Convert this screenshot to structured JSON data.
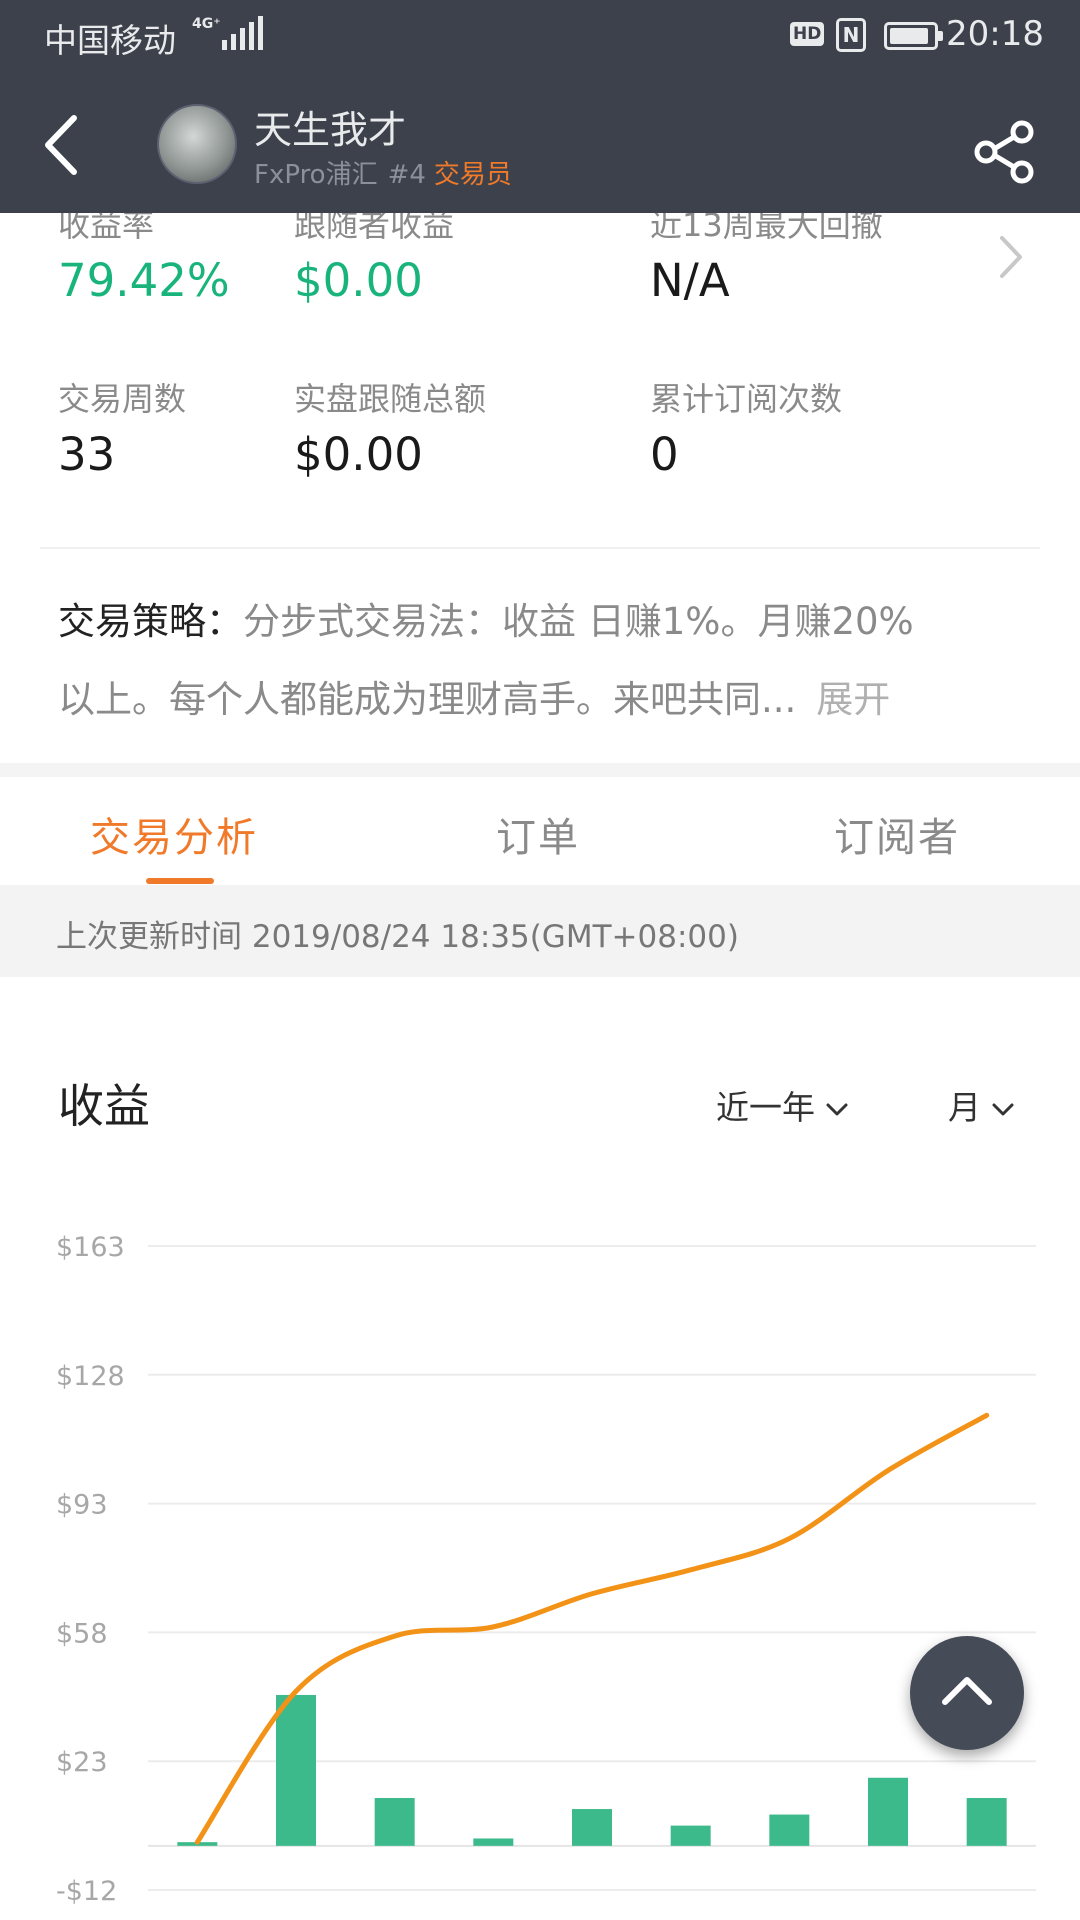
{
  "status_bar": {
    "carrier": "中国移动",
    "network": "4G⁺",
    "hd": "HD",
    "nfc": "N",
    "battery_level": 0.9,
    "time": "20:18"
  },
  "header": {
    "name": "天生我才",
    "broker": "FxPro浦汇",
    "rank": "#4",
    "role": "交易员",
    "back_icon": "back-arrow-icon",
    "share_icon": "share-icon",
    "bg_color": "#3c414b"
  },
  "stats": {
    "return_rate": {
      "label": "收益率",
      "value": "79.42%"
    },
    "follower_profit": {
      "label": "跟随者收益",
      "value": "$0.00"
    },
    "max_drawdown": {
      "label": "近13周最大回撤",
      "value": "N/A"
    },
    "trade_weeks": {
      "label": "交易周数",
      "value": "33"
    },
    "live_follow_total": {
      "label": "实盘跟随总额",
      "value": "$0.00"
    },
    "total_subscriptions": {
      "label": "累计订阅次数",
      "value": "0"
    }
  },
  "strategy": {
    "label": "交易策略：",
    "line1": "分步式交易法：收益 日赚1%。月赚20%",
    "line2": "以上。每个人都能成为理财高手。来吧共同...",
    "expand": "展开"
  },
  "tabs": [
    {
      "label": "交易分析",
      "active": true
    },
    {
      "label": "订单",
      "active": false
    },
    {
      "label": "订阅者",
      "active": false
    }
  ],
  "last_updated": "上次更新时间 2019/08/24 18:35(GMT+08:00)",
  "chart_section": {
    "title": "收益",
    "period_filter": "近一年",
    "interval_filter": "月"
  },
  "colors": {
    "accent": "#f07a2a",
    "positive": "#18b47b",
    "bar": "#3dba8c",
    "line": "#f29318"
  },
  "chart_data": {
    "type": "bar+line",
    "y_ticks": [
      "$163",
      "$128",
      "$93",
      "$58",
      "$23",
      "-$12"
    ],
    "ylim": [
      -12,
      163
    ],
    "grid": true,
    "bars": {
      "name": "",
      "values": [
        1,
        41,
        13,
        2,
        10,
        5.5,
        8.5,
        18.5,
        13
      ]
    },
    "line": {
      "name": "",
      "values": [
        1,
        42,
        57,
        59.5,
        68.5,
        75,
        83.5,
        102,
        117
      ]
    }
  }
}
